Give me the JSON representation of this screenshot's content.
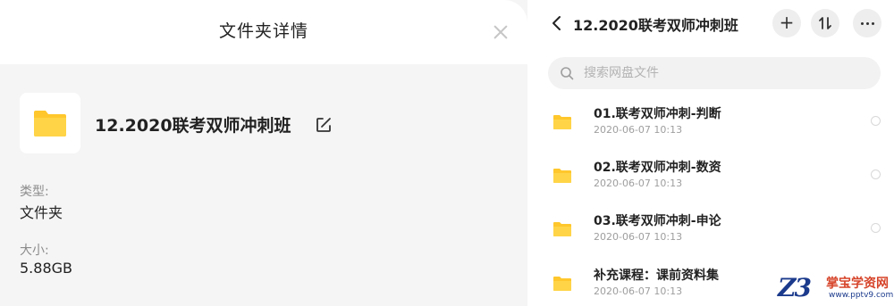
{
  "details": {
    "title": "文件夹详情",
    "folder_name": "12.2020联考双师冲刺班",
    "type_label": "类型:",
    "type_value": "文件夹",
    "size_label": "大小:",
    "size_value": "5.88GB"
  },
  "folder_view": {
    "title": "12.2020联考双师冲刺班",
    "add_label": "+",
    "search_placeholder": "搜索网盘文件",
    "items": [
      {
        "name": "01.联考双师冲刺-判断",
        "date": "2020-06-07  10:13"
      },
      {
        "name": "02.联考双师冲刺-数资",
        "date": "2020-06-07  10:13"
      },
      {
        "name": "03.联考双师冲刺-申论",
        "date": "2020-06-07  10:13"
      },
      {
        "name": "补充课程：课前资料集",
        "date": "2020-06-07  10:13"
      }
    ]
  },
  "watermark": {
    "logo": "Z3",
    "name": "掌宝学资网",
    "url": "www.pptv9.com"
  },
  "colors": {
    "folder_yellow": "#ffc72c",
    "watermark_red": "#d6442a",
    "watermark_blue": "#1b3a8c"
  },
  "icons": [
    "close-icon",
    "folder-icon",
    "edit-icon",
    "back-icon",
    "add-icon",
    "sort-icon",
    "more-icon",
    "search-icon"
  ]
}
